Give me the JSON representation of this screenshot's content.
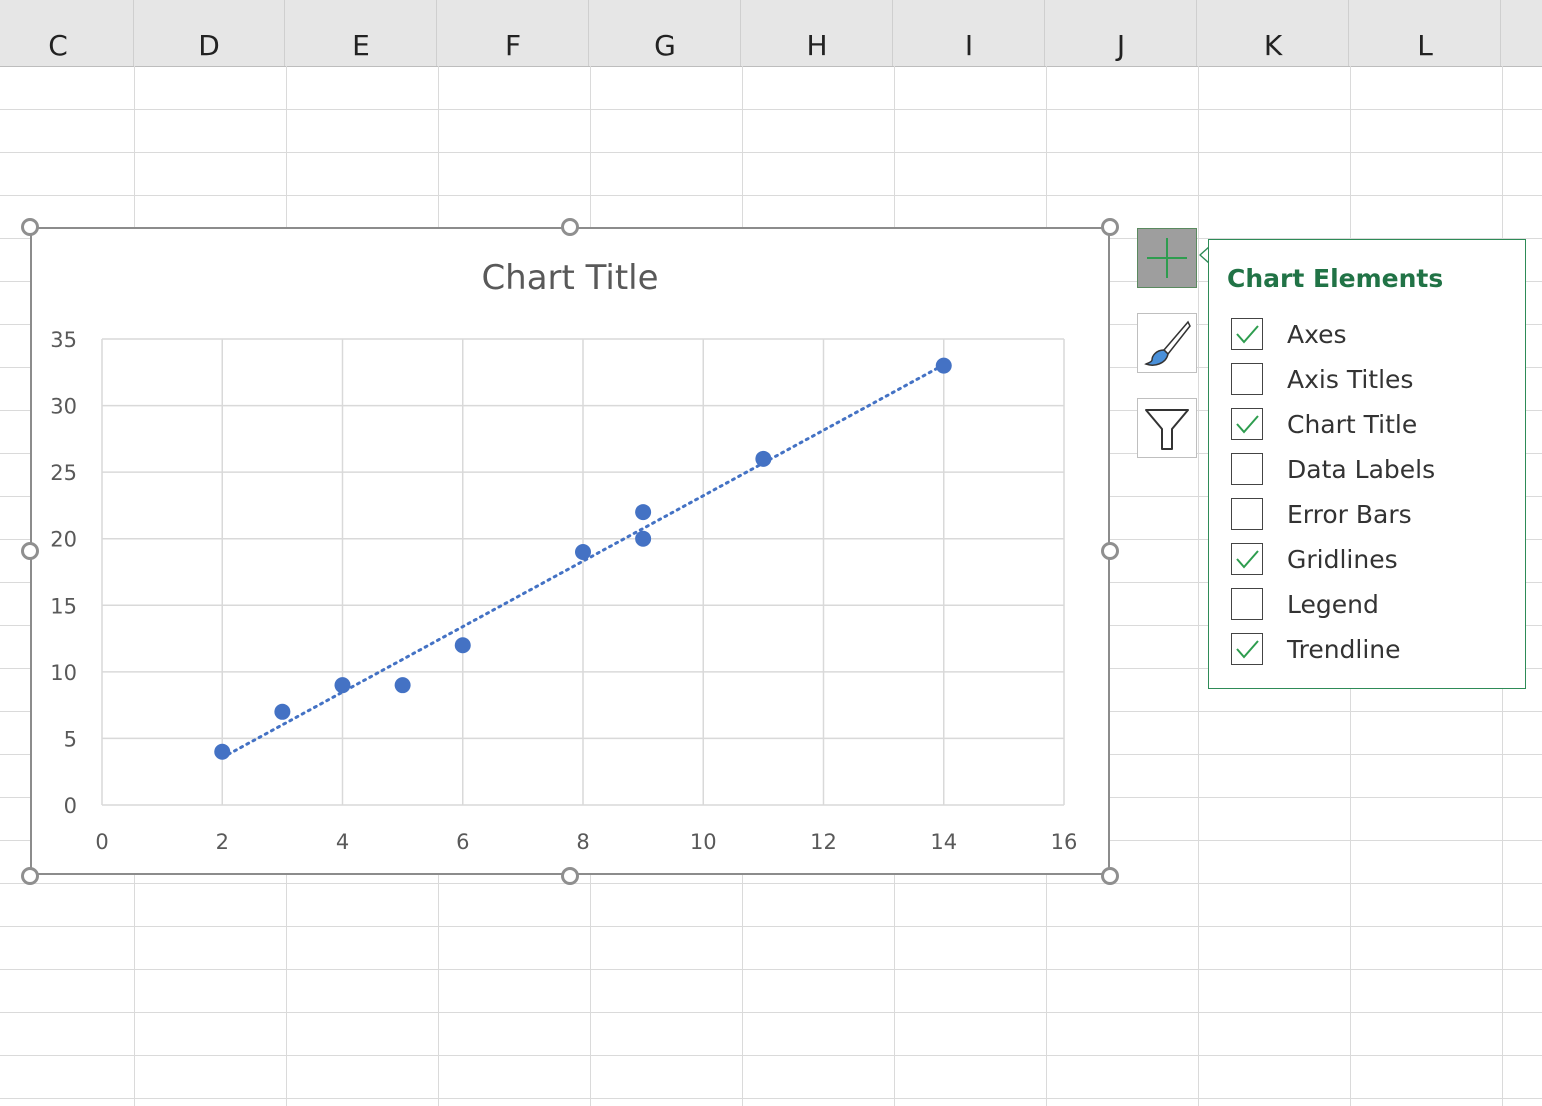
{
  "spreadsheet": {
    "columns": [
      "C",
      "D",
      "E",
      "F",
      "G",
      "H",
      "I",
      "J",
      "K",
      "L"
    ]
  },
  "chart_data": {
    "type": "scatter",
    "title": "Chart Title",
    "xlabel": "",
    "ylabel": "",
    "xlim": [
      0,
      16
    ],
    "ylim": [
      0,
      35
    ],
    "x_ticks": [
      0,
      2,
      4,
      6,
      8,
      10,
      12,
      14,
      16
    ],
    "y_ticks": [
      0,
      5,
      10,
      15,
      20,
      25,
      30,
      35
    ],
    "grid": true,
    "legend": "none",
    "marker_color": "#4472c4",
    "series": [
      {
        "x": [
          2,
          3,
          4,
          5,
          6,
          8,
          9,
          9,
          11,
          14
        ],
        "y": [
          4,
          7,
          9,
          9,
          12,
          19,
          22,
          20,
          26,
          33
        ]
      }
    ],
    "trendline": {
      "type": "linear",
      "style": "dotted",
      "color": "#4472c4",
      "x_range": [
        2,
        14
      ]
    }
  },
  "side_buttons": {
    "elements_icon": "plus-icon",
    "styles_icon": "paintbrush-icon",
    "filters_icon": "funnel-icon"
  },
  "elements_panel": {
    "title": "Chart Elements",
    "options": [
      {
        "label": "Axes",
        "checked": true
      },
      {
        "label": "Axis Titles",
        "checked": false
      },
      {
        "label": "Chart Title",
        "checked": true
      },
      {
        "label": "Data Labels",
        "checked": false
      },
      {
        "label": "Error Bars",
        "checked": false
      },
      {
        "label": "Gridlines",
        "checked": true
      },
      {
        "label": "Legend",
        "checked": false
      },
      {
        "label": "Trendline",
        "checked": true
      }
    ]
  },
  "colors": {
    "accent_green": "#217346",
    "marker_blue": "#4472c4"
  }
}
